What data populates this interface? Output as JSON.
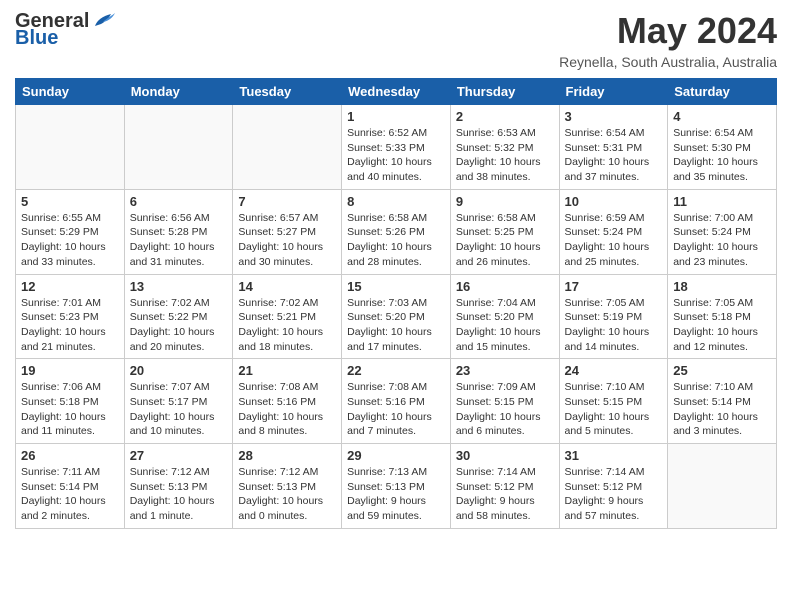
{
  "header": {
    "logo_general": "General",
    "logo_blue": "Blue",
    "month_title": "May 2024",
    "location": "Reynella, South Australia, Australia"
  },
  "weekdays": [
    "Sunday",
    "Monday",
    "Tuesday",
    "Wednesday",
    "Thursday",
    "Friday",
    "Saturday"
  ],
  "weeks": [
    [
      {
        "day": "",
        "info": ""
      },
      {
        "day": "",
        "info": ""
      },
      {
        "day": "",
        "info": ""
      },
      {
        "day": "1",
        "info": "Sunrise: 6:52 AM\nSunset: 5:33 PM\nDaylight: 10 hours\nand 40 minutes."
      },
      {
        "day": "2",
        "info": "Sunrise: 6:53 AM\nSunset: 5:32 PM\nDaylight: 10 hours\nand 38 minutes."
      },
      {
        "day": "3",
        "info": "Sunrise: 6:54 AM\nSunset: 5:31 PM\nDaylight: 10 hours\nand 37 minutes."
      },
      {
        "day": "4",
        "info": "Sunrise: 6:54 AM\nSunset: 5:30 PM\nDaylight: 10 hours\nand 35 minutes."
      }
    ],
    [
      {
        "day": "5",
        "info": "Sunrise: 6:55 AM\nSunset: 5:29 PM\nDaylight: 10 hours\nand 33 minutes."
      },
      {
        "day": "6",
        "info": "Sunrise: 6:56 AM\nSunset: 5:28 PM\nDaylight: 10 hours\nand 31 minutes."
      },
      {
        "day": "7",
        "info": "Sunrise: 6:57 AM\nSunset: 5:27 PM\nDaylight: 10 hours\nand 30 minutes."
      },
      {
        "day": "8",
        "info": "Sunrise: 6:58 AM\nSunset: 5:26 PM\nDaylight: 10 hours\nand 28 minutes."
      },
      {
        "day": "9",
        "info": "Sunrise: 6:58 AM\nSunset: 5:25 PM\nDaylight: 10 hours\nand 26 minutes."
      },
      {
        "day": "10",
        "info": "Sunrise: 6:59 AM\nSunset: 5:24 PM\nDaylight: 10 hours\nand 25 minutes."
      },
      {
        "day": "11",
        "info": "Sunrise: 7:00 AM\nSunset: 5:24 PM\nDaylight: 10 hours\nand 23 minutes."
      }
    ],
    [
      {
        "day": "12",
        "info": "Sunrise: 7:01 AM\nSunset: 5:23 PM\nDaylight: 10 hours\nand 21 minutes."
      },
      {
        "day": "13",
        "info": "Sunrise: 7:02 AM\nSunset: 5:22 PM\nDaylight: 10 hours\nand 20 minutes."
      },
      {
        "day": "14",
        "info": "Sunrise: 7:02 AM\nSunset: 5:21 PM\nDaylight: 10 hours\nand 18 minutes."
      },
      {
        "day": "15",
        "info": "Sunrise: 7:03 AM\nSunset: 5:20 PM\nDaylight: 10 hours\nand 17 minutes."
      },
      {
        "day": "16",
        "info": "Sunrise: 7:04 AM\nSunset: 5:20 PM\nDaylight: 10 hours\nand 15 minutes."
      },
      {
        "day": "17",
        "info": "Sunrise: 7:05 AM\nSunset: 5:19 PM\nDaylight: 10 hours\nand 14 minutes."
      },
      {
        "day": "18",
        "info": "Sunrise: 7:05 AM\nSunset: 5:18 PM\nDaylight: 10 hours\nand 12 minutes."
      }
    ],
    [
      {
        "day": "19",
        "info": "Sunrise: 7:06 AM\nSunset: 5:18 PM\nDaylight: 10 hours\nand 11 minutes."
      },
      {
        "day": "20",
        "info": "Sunrise: 7:07 AM\nSunset: 5:17 PM\nDaylight: 10 hours\nand 10 minutes."
      },
      {
        "day": "21",
        "info": "Sunrise: 7:08 AM\nSunset: 5:16 PM\nDaylight: 10 hours\nand 8 minutes."
      },
      {
        "day": "22",
        "info": "Sunrise: 7:08 AM\nSunset: 5:16 PM\nDaylight: 10 hours\nand 7 minutes."
      },
      {
        "day": "23",
        "info": "Sunrise: 7:09 AM\nSunset: 5:15 PM\nDaylight: 10 hours\nand 6 minutes."
      },
      {
        "day": "24",
        "info": "Sunrise: 7:10 AM\nSunset: 5:15 PM\nDaylight: 10 hours\nand 5 minutes."
      },
      {
        "day": "25",
        "info": "Sunrise: 7:10 AM\nSunset: 5:14 PM\nDaylight: 10 hours\nand 3 minutes."
      }
    ],
    [
      {
        "day": "26",
        "info": "Sunrise: 7:11 AM\nSunset: 5:14 PM\nDaylight: 10 hours\nand 2 minutes."
      },
      {
        "day": "27",
        "info": "Sunrise: 7:12 AM\nSunset: 5:13 PM\nDaylight: 10 hours\nand 1 minute."
      },
      {
        "day": "28",
        "info": "Sunrise: 7:12 AM\nSunset: 5:13 PM\nDaylight: 10 hours\nand 0 minutes."
      },
      {
        "day": "29",
        "info": "Sunrise: 7:13 AM\nSunset: 5:13 PM\nDaylight: 9 hours\nand 59 minutes."
      },
      {
        "day": "30",
        "info": "Sunrise: 7:14 AM\nSunset: 5:12 PM\nDaylight: 9 hours\nand 58 minutes."
      },
      {
        "day": "31",
        "info": "Sunrise: 7:14 AM\nSunset: 5:12 PM\nDaylight: 9 hours\nand 57 minutes."
      },
      {
        "day": "",
        "info": ""
      }
    ]
  ]
}
